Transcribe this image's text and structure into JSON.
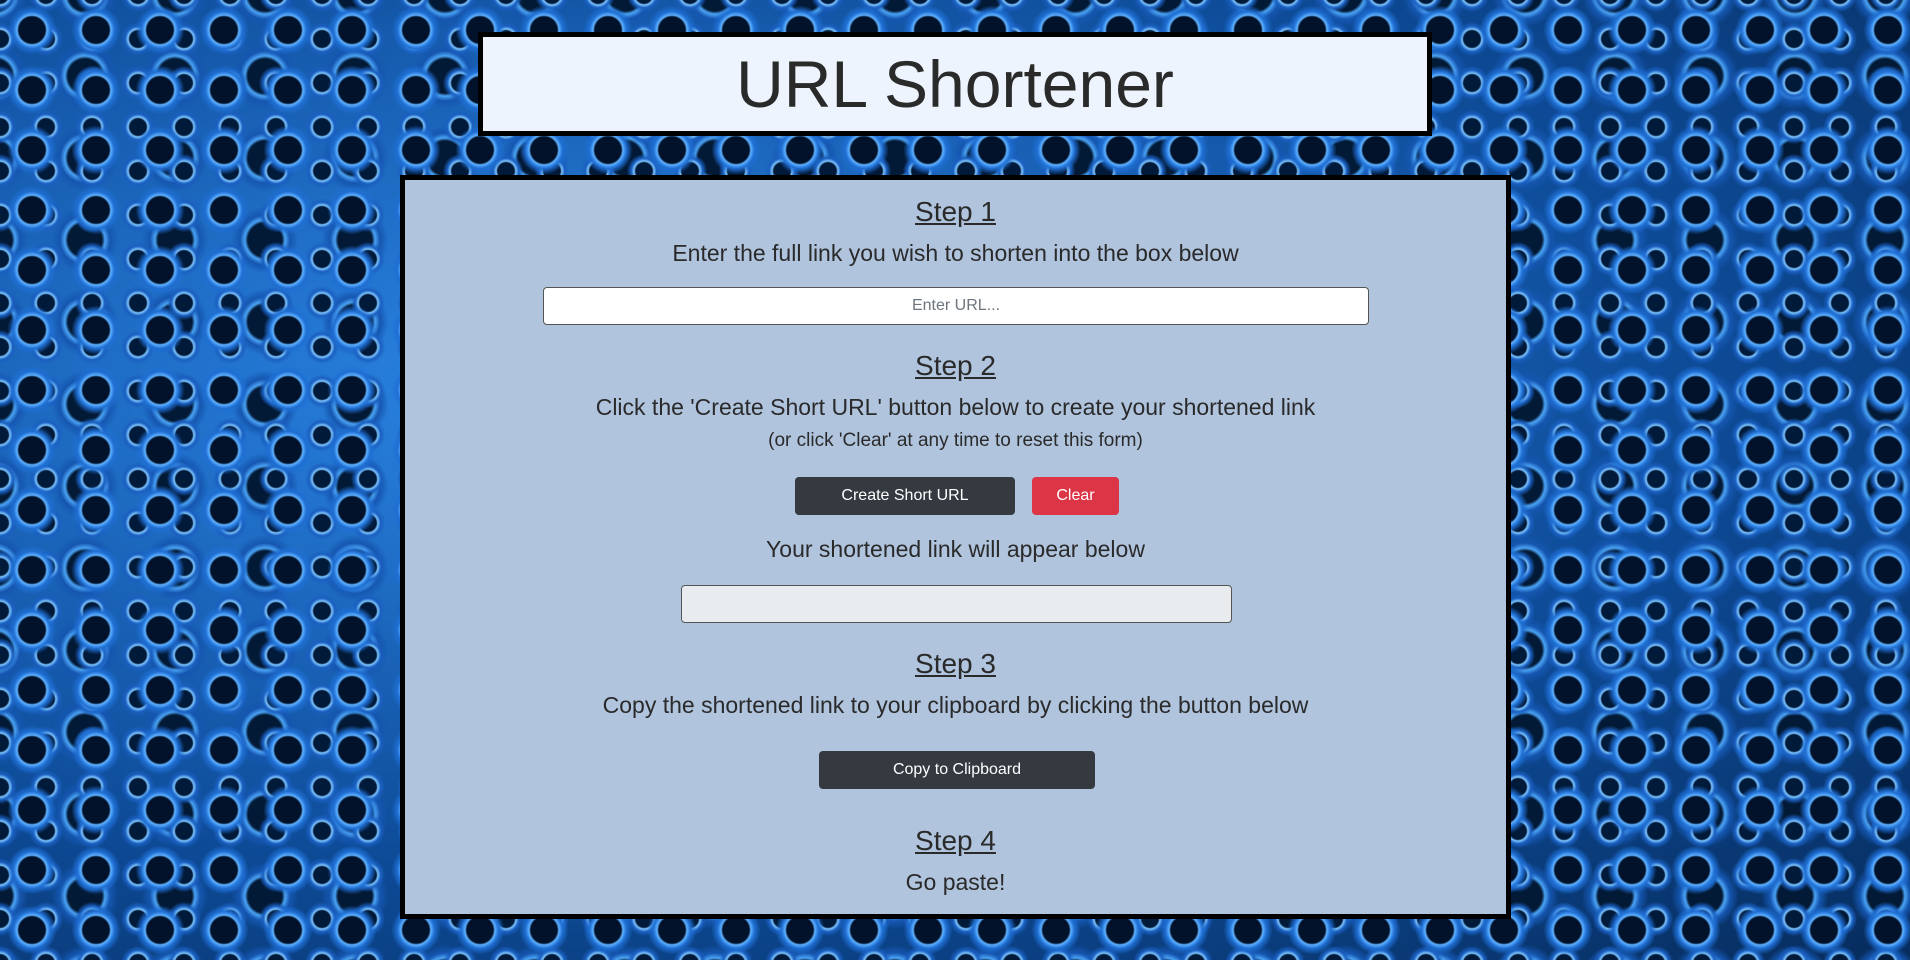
{
  "header": {
    "title": "URL Shortener"
  },
  "step1": {
    "heading": "Step 1",
    "text": "Enter the full link you wish to shorten into the box below",
    "input_placeholder": "Enter URL..."
  },
  "step2": {
    "heading": "Step 2",
    "text": "Click the 'Create Short URL' button below to create your shortened link",
    "subtext": "(or click 'Clear' at any time to reset this form)",
    "create_label": "Create Short URL",
    "clear_label": "Clear",
    "result_text": "Your shortened link will appear below",
    "output_value": ""
  },
  "step3": {
    "heading": "Step 3",
    "text": "Copy the shortened link to your clipboard by clicking the button below",
    "copy_label": "Copy to Clipboard"
  },
  "step4": {
    "heading": "Step 4",
    "text": "Go paste!"
  },
  "colors": {
    "panel_bg": "#b0c4de",
    "title_bg": "#edf4fd",
    "dark_button": "#343a40",
    "danger_button": "#dc3545",
    "background_theme": "#1f6fd4"
  }
}
